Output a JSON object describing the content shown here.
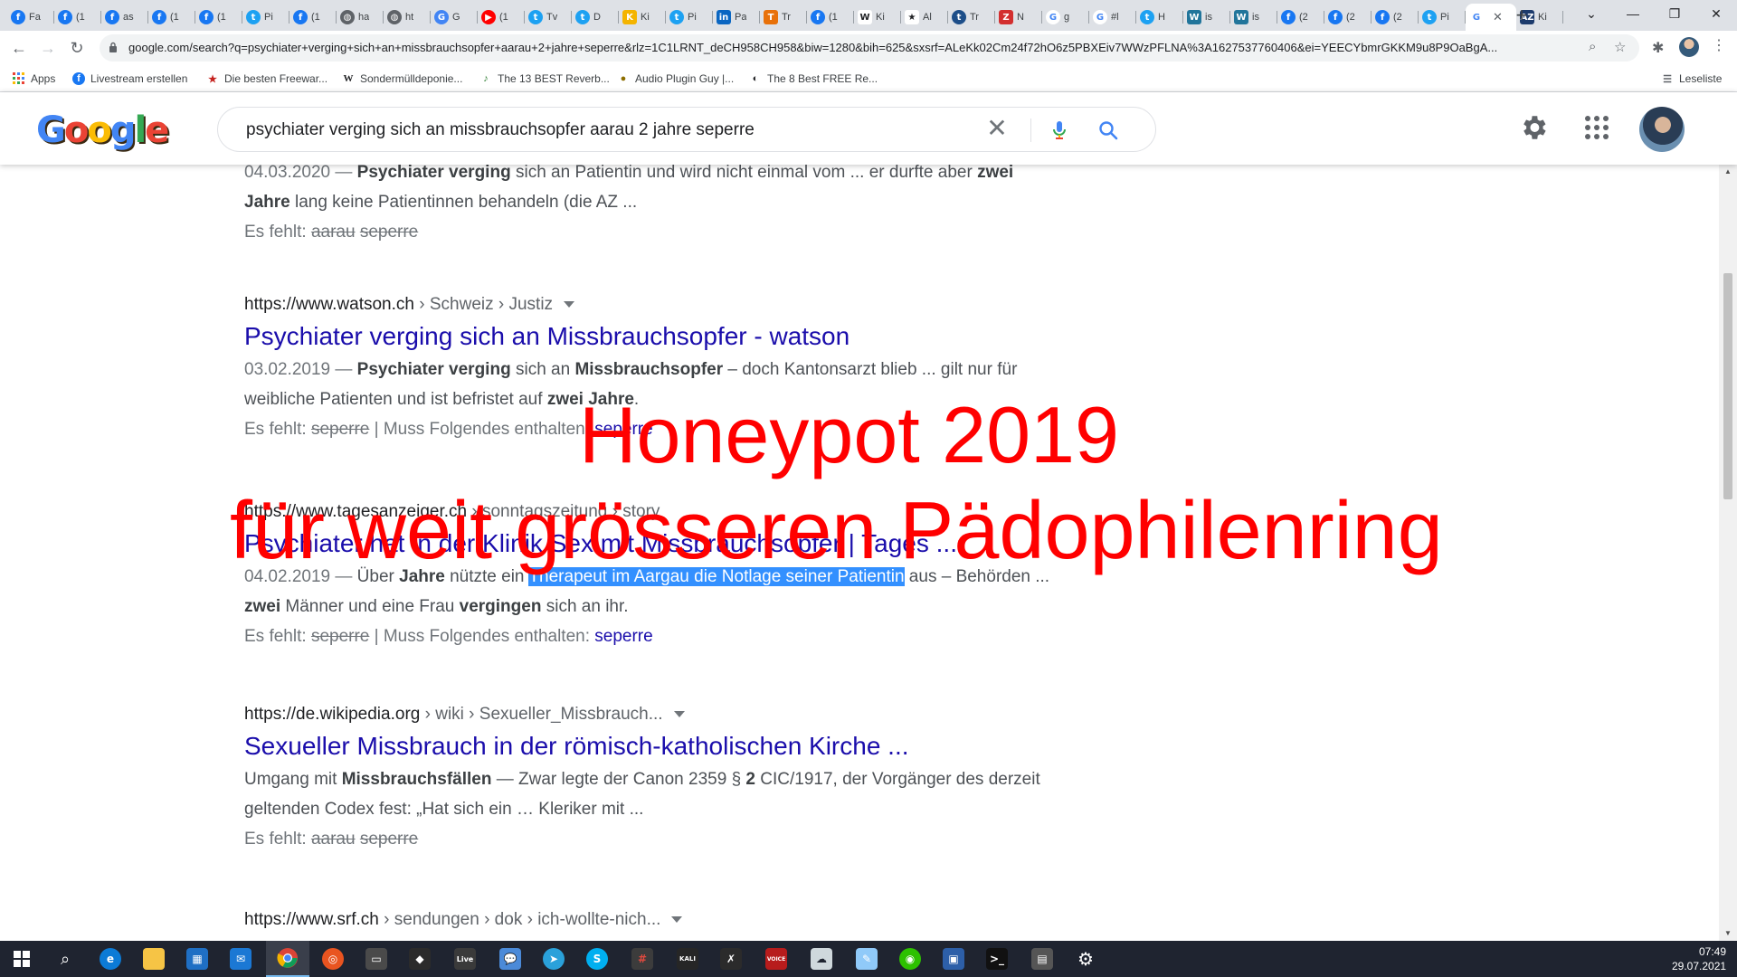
{
  "browser": {
    "tabs": [
      {
        "label": "Fa",
        "icon": "facebook-icon",
        "color": "#1877f2",
        "glyph": "f"
      },
      {
        "label": "(1",
        "icon": "facebook-icon",
        "color": "#1877f2",
        "glyph": "f"
      },
      {
        "label": "as",
        "icon": "facebook-icon",
        "color": "#1877f2",
        "glyph": "f"
      },
      {
        "label": "(1",
        "icon": "facebook-icon",
        "color": "#1877f2",
        "glyph": "f"
      },
      {
        "label": "(1",
        "icon": "facebook-icon",
        "color": "#1877f2",
        "glyph": "f"
      },
      {
        "label": "Pi",
        "icon": "twitter-icon",
        "color": "#1da1f2",
        "glyph": "t"
      },
      {
        "label": "(1",
        "icon": "facebook-icon",
        "color": "#1877f2",
        "glyph": "f"
      },
      {
        "label": "ha",
        "icon": "globe-icon",
        "color": "#5f6368",
        "glyph": "◍"
      },
      {
        "label": "ht",
        "icon": "globe-icon",
        "color": "#5f6368",
        "glyph": "◍"
      },
      {
        "label": "G",
        "icon": "google-translate-icon",
        "color": "#4285f4",
        "glyph": "G"
      },
      {
        "label": "(1",
        "icon": "youtube-icon",
        "color": "#ff0000",
        "glyph": "▶"
      },
      {
        "label": "Tv",
        "icon": "twitter-icon",
        "color": "#1da1f2",
        "glyph": "t"
      },
      {
        "label": "D",
        "icon": "twitter-icon",
        "color": "#1da1f2",
        "glyph": "t"
      },
      {
        "label": "Ki",
        "icon": "yellow-app-icon",
        "color": "#f4b400",
        "glyph": "K"
      },
      {
        "label": "Pi",
        "icon": "twitter-icon",
        "color": "#1da1f2",
        "glyph": "t"
      },
      {
        "label": "Pa",
        "icon": "linkedin-icon",
        "color": "#0a66c2",
        "glyph": "in"
      },
      {
        "label": "Tr",
        "icon": "orange-app-icon",
        "color": "#e8710a",
        "glyph": "T"
      },
      {
        "label": "(1",
        "icon": "facebook-icon",
        "color": "#1877f2",
        "glyph": "f"
      },
      {
        "label": "Ki",
        "icon": "wikipedia-icon",
        "color": "#ffffff",
        "glyph": "W"
      },
      {
        "label": "Al",
        "icon": "star-icon",
        "color": "#ffffff",
        "glyph": "★"
      },
      {
        "label": "Tr",
        "icon": "twitter-blue-icon",
        "color": "#1d4e89",
        "glyph": "t"
      },
      {
        "label": "N",
        "icon": "zeit-icon",
        "color": "#d32f2f",
        "glyph": "Z"
      },
      {
        "label": "g",
        "icon": "google-icon",
        "color": "#ffffff",
        "glyph": "G"
      },
      {
        "label": "#l",
        "icon": "google-icon",
        "color": "#ffffff",
        "glyph": "G"
      },
      {
        "label": "H",
        "icon": "twitter-icon",
        "color": "#1da1f2",
        "glyph": "t"
      },
      {
        "label": "is",
        "icon": "wordpress-icon",
        "color": "#21759b",
        "glyph": "W"
      },
      {
        "label": "is",
        "icon": "wordpress-icon",
        "color": "#21759b",
        "glyph": "W"
      },
      {
        "label": "(2",
        "icon": "facebook-icon",
        "color": "#1877f2",
        "glyph": "f"
      },
      {
        "label": "(2",
        "icon": "facebook-icon",
        "color": "#1877f2",
        "glyph": "f"
      },
      {
        "label": "(2",
        "icon": "facebook-icon",
        "color": "#1877f2",
        "glyph": "f"
      },
      {
        "label": "Pi",
        "icon": "twitter-icon",
        "color": "#1da1f2",
        "glyph": "t"
      },
      {
        "label": "",
        "icon": "google-icon",
        "color": "#ffffff",
        "glyph": "G",
        "active": true
      },
      {
        "label": "Ki",
        "icon": "az-icon",
        "color": "#1d3b6c",
        "glyph": "AZ"
      }
    ],
    "url": "google.com/search?q=psychiater+verging+sich+an+missbrauchsopfer+aarau+2+jahre+seperre&rlz=1C1LRNT_deCH958CH958&biw=1280&bih=625&sxsrf=ALeKk02Cm24f72hO6z5PBXEiv7WWzPFLNA%3A1627537760406&ei=YEECYbmrGKKM9u8P9OaBgA...",
    "bookmarks": [
      {
        "label": "Apps",
        "icon": "apps-grid-icon"
      },
      {
        "label": "Livestream erstellen",
        "icon": "facebook-icon"
      },
      {
        "label": "Die besten Freewar...",
        "icon": "star-icon"
      },
      {
        "label": "Sondermülldeponie...",
        "icon": "wikipedia-icon"
      },
      {
        "label": "The 13 BEST Reverb...",
        "icon": "music-icon"
      },
      {
        "label": "Audio Plugin Guy |...",
        "icon": "plugin-icon"
      },
      {
        "label": "The 8 Best FREE Re...",
        "icon": "moon-icon"
      }
    ],
    "reading_list": "Leseliste"
  },
  "search": {
    "query": "psychiater verging sich an missbrauchsopfer aarau 2 jahre seperre"
  },
  "results": [
    {
      "cite_domain": "",
      "cite_path": "",
      "title": "",
      "date": "04.03.2020 —",
      "snippet_parts": [
        {
          "t": " ",
          "b": false
        },
        {
          "t": "Psychiater verging",
          "b": true
        },
        {
          "t": " sich an Patientin und wird nicht einmal vom ... er durfte aber ",
          "b": false
        },
        {
          "t": "zwei Jahre",
          "b": true
        },
        {
          "t": " lang keine Patientinnen behandeln (die AZ ...",
          "b": false
        }
      ],
      "missing_label": "Es fehlt:",
      "missing_terms": [
        "aarau",
        "seperre"
      ],
      "must_include_label": "",
      "must_include_term": ""
    },
    {
      "cite_domain": "https://www.watson.ch",
      "cite_path": " › Schweiz › Justiz",
      "title": "Psychiater verging sich an Missbrauchsopfer - watson",
      "date": "03.02.2019 —",
      "snippet_parts": [
        {
          "t": " ",
          "b": false
        },
        {
          "t": "Psychiater verging",
          "b": true
        },
        {
          "t": " sich an ",
          "b": false
        },
        {
          "t": "Missbrauchsopfer",
          "b": true
        },
        {
          "t": " – doch Kantonsarzt blieb ... gilt nur für weibliche Patienten und ist befristet auf ",
          "b": false
        },
        {
          "t": "zwei Jahre",
          "b": true
        },
        {
          "t": ".",
          "b": false
        }
      ],
      "missing_label": "Es fehlt:",
      "missing_terms": [
        "seperre"
      ],
      "must_include_label": "| Muss Folgendes enthalten:",
      "must_include_term": "seperre"
    },
    {
      "cite_domain": "https://www.tagesanzeiger.ch",
      "cite_path": " › sonntagszeitung › story",
      "title": "Psychiater hat in der Klinik Sex mit Missbrauchsopfer | Tages ...",
      "date": "04.02.2019 —",
      "snippet_parts": [
        {
          "t": " Über ",
          "b": false
        },
        {
          "t": "Jahre",
          "b": true
        },
        {
          "t": " nützte ein ",
          "b": false
        },
        {
          "t": "Therapeut im Aargau die Notlage seiner Patientin",
          "b": false,
          "hl": true
        },
        {
          "t": " aus – Behörden ... ",
          "b": false
        },
        {
          "t": "zwei",
          "b": true
        },
        {
          "t": " Männer und eine Frau ",
          "b": false
        },
        {
          "t": "vergingen",
          "b": true
        },
        {
          "t": " sich an ihr.",
          "b": false
        }
      ],
      "missing_label": "Es fehlt:",
      "missing_terms": [
        "seperre"
      ],
      "must_include_label": "| Muss Folgendes enthalten:",
      "must_include_term": "seperre"
    },
    {
      "cite_domain": "https://de.wikipedia.org",
      "cite_path": " › wiki › Sexueller_Missbrauch...",
      "title": "Sexueller Missbrauch in der römisch-katholischen Kirche ...",
      "date": "",
      "snippet_parts": [
        {
          "t": "Umgang mit ",
          "b": false
        },
        {
          "t": "Missbrauchsfällen",
          "b": true
        },
        {
          "t": " — Zwar legte der Canon 2359 § ",
          "b": false
        },
        {
          "t": "2",
          "b": true
        },
        {
          "t": " CIC/1917, der Vorgänger des derzeit geltenden Codex fest: „Hat sich ein … Kleriker mit ...",
          "b": false
        }
      ],
      "missing_label": "Es fehlt:",
      "missing_terms": [
        "aarau",
        "seperre"
      ],
      "must_include_label": "",
      "must_include_term": ""
    },
    {
      "cite_domain": "https://www.srf.ch",
      "cite_path": " › sendungen › dok › ich-wollte-nich...",
      "title": "",
      "date": "",
      "snippet_parts": [],
      "missing_label": "",
      "missing_terms": [],
      "must_include_label": "",
      "must_include_term": ""
    }
  ],
  "overlay": {
    "line1": "Honeypot 2019",
    "line2": "für weit grösseren Pädophilenring",
    "color": "#ff0000"
  },
  "taskbar": {
    "time": "07:49",
    "date": "29.07.2021"
  }
}
